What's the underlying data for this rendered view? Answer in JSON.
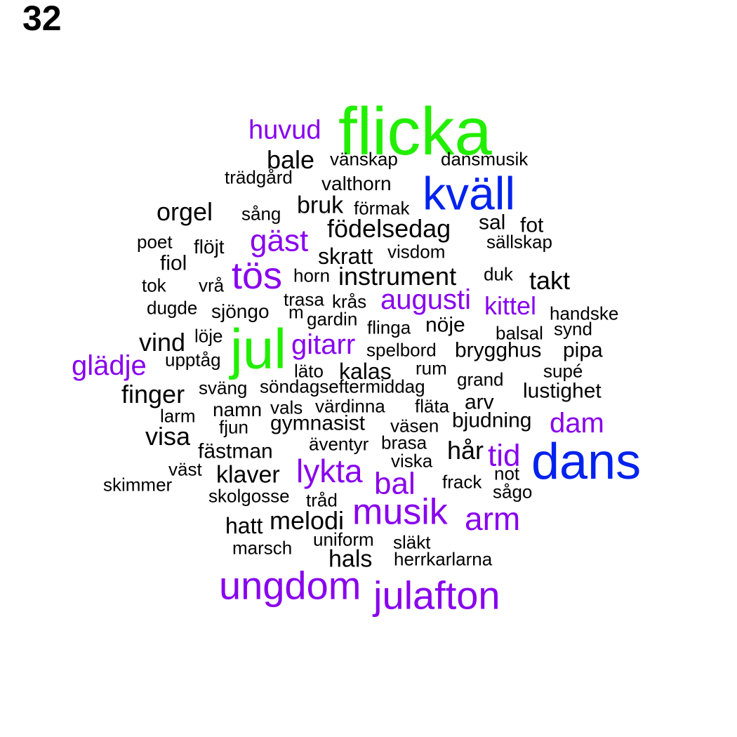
{
  "page_number": "32",
  "colors": {
    "green": "#22ee00",
    "blue": "#0022ee",
    "purple": "#8800ee",
    "black": "#000000"
  },
  "words": [
    {
      "t": "flicka",
      "c": "green"
    },
    {
      "t": "huvud",
      "c": "purple"
    },
    {
      "t": "bale",
      "c": "black"
    },
    {
      "t": "vänskap",
      "c": "black"
    },
    {
      "t": "dansmusik",
      "c": "black"
    },
    {
      "t": "trädgård",
      "c": "black"
    },
    {
      "t": "valthorn",
      "c": "black"
    },
    {
      "t": "kväll",
      "c": "blue"
    },
    {
      "t": "orgel",
      "c": "black"
    },
    {
      "t": "bruk",
      "c": "black"
    },
    {
      "t": "sång",
      "c": "black"
    },
    {
      "t": "förmak",
      "c": "black"
    },
    {
      "t": "födelsedag",
      "c": "black"
    },
    {
      "t": "sal",
      "c": "black"
    },
    {
      "t": "fot",
      "c": "black"
    },
    {
      "t": "gäst",
      "c": "purple"
    },
    {
      "t": "poet",
      "c": "black"
    },
    {
      "t": "flöjt",
      "c": "black"
    },
    {
      "t": "sällskap",
      "c": "black"
    },
    {
      "t": "skratt",
      "c": "black"
    },
    {
      "t": "visdom",
      "c": "black"
    },
    {
      "t": "fiol",
      "c": "black"
    },
    {
      "t": "tös",
      "c": "purple"
    },
    {
      "t": "horn",
      "c": "black"
    },
    {
      "t": "instrument",
      "c": "black"
    },
    {
      "t": "duk",
      "c": "black"
    },
    {
      "t": "takt",
      "c": "black"
    },
    {
      "t": "tok",
      "c": "black"
    },
    {
      "t": "vrå",
      "c": "black"
    },
    {
      "t": "trasa",
      "c": "black"
    },
    {
      "t": "krås",
      "c": "black"
    },
    {
      "t": "augusti",
      "c": "purple"
    },
    {
      "t": "kittel",
      "c": "purple"
    },
    {
      "t": "dugde",
      "c": "black"
    },
    {
      "t": "sjöngo",
      "c": "black"
    },
    {
      "t": "m",
      "c": "black"
    },
    {
      "t": "gardin",
      "c": "black"
    },
    {
      "t": "handske",
      "c": "black"
    },
    {
      "t": "jul",
      "c": "green"
    },
    {
      "t": "flinga",
      "c": "black"
    },
    {
      "t": "nöje",
      "c": "black"
    },
    {
      "t": "balsal",
      "c": "black"
    },
    {
      "t": "synd",
      "c": "black"
    },
    {
      "t": "löje",
      "c": "black"
    },
    {
      "t": "vind",
      "c": "black"
    },
    {
      "t": "gitarr",
      "c": "purple"
    },
    {
      "t": "spelbord",
      "c": "black"
    },
    {
      "t": "brygghus",
      "c": "black"
    },
    {
      "t": "pipa",
      "c": "black"
    },
    {
      "t": "glädje",
      "c": "purple"
    },
    {
      "t": "upptåg",
      "c": "black"
    },
    {
      "t": "läto",
      "c": "black"
    },
    {
      "t": "kalas",
      "c": "black"
    },
    {
      "t": "rum",
      "c": "black"
    },
    {
      "t": "supé",
      "c": "black"
    },
    {
      "t": "grand",
      "c": "black"
    },
    {
      "t": "finger",
      "c": "black"
    },
    {
      "t": "sväng",
      "c": "black"
    },
    {
      "t": "söndagseftermiddag",
      "c": "black"
    },
    {
      "t": "lustighet",
      "c": "black"
    },
    {
      "t": "arv",
      "c": "black"
    },
    {
      "t": "larm",
      "c": "black"
    },
    {
      "t": "namn",
      "c": "black"
    },
    {
      "t": "vals",
      "c": "black"
    },
    {
      "t": "värdinna",
      "c": "black"
    },
    {
      "t": "fläta",
      "c": "black"
    },
    {
      "t": "dam",
      "c": "purple"
    },
    {
      "t": "fjun",
      "c": "black"
    },
    {
      "t": "gymnasist",
      "c": "black"
    },
    {
      "t": "väsen",
      "c": "black"
    },
    {
      "t": "bjudning",
      "c": "black"
    },
    {
      "t": "visa",
      "c": "black"
    },
    {
      "t": "äventyr",
      "c": "black"
    },
    {
      "t": "brasa",
      "c": "black"
    },
    {
      "t": "hår",
      "c": "black"
    },
    {
      "t": "fästman",
      "c": "black"
    },
    {
      "t": "tid",
      "c": "purple"
    },
    {
      "t": "dans",
      "c": "blue"
    },
    {
      "t": "viska",
      "c": "black"
    },
    {
      "t": "väst",
      "c": "black"
    },
    {
      "t": "lykta",
      "c": "purple"
    },
    {
      "t": "klaver",
      "c": "black"
    },
    {
      "t": "not",
      "c": "black"
    },
    {
      "t": "bal",
      "c": "purple"
    },
    {
      "t": "frack",
      "c": "black"
    },
    {
      "t": "skimmer",
      "c": "black"
    },
    {
      "t": "sågo",
      "c": "black"
    },
    {
      "t": "skolgosse",
      "c": "black"
    },
    {
      "t": "tråd",
      "c": "black"
    },
    {
      "t": "musik",
      "c": "purple"
    },
    {
      "t": "arm",
      "c": "purple"
    },
    {
      "t": "hatt",
      "c": "black"
    },
    {
      "t": "melodi",
      "c": "black"
    },
    {
      "t": "uniform",
      "c": "black"
    },
    {
      "t": "släkt",
      "c": "black"
    },
    {
      "t": "marsch",
      "c": "black"
    },
    {
      "t": "hals",
      "c": "black"
    },
    {
      "t": "herrkarlarna",
      "c": "black"
    },
    {
      "t": "ungdom",
      "c": "purple"
    },
    {
      "t": "julafton",
      "c": "purple"
    }
  ]
}
